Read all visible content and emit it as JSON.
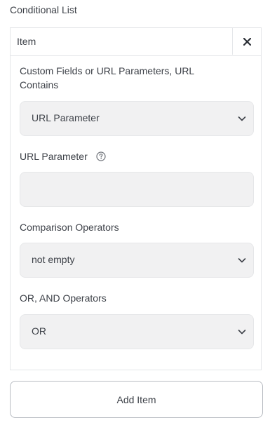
{
  "section": {
    "title": "Conditional List"
  },
  "item": {
    "title": "Item",
    "close_icon": "close-icon",
    "fields": {
      "source_label": "Custom Fields or URL Parameters, URL Contains",
      "source_value": "URL Parameter",
      "param_label": "URL Parameter",
      "param_value": "",
      "comparison_label": "Comparison Operators",
      "comparison_value": "not empty",
      "logic_label": "OR, AND Operators",
      "logic_value": "OR"
    }
  },
  "actions": {
    "add_item_label": "Add Item"
  },
  "icons": {
    "help": "question-circle-icon",
    "dropdown": "chevron-down-icon"
  }
}
